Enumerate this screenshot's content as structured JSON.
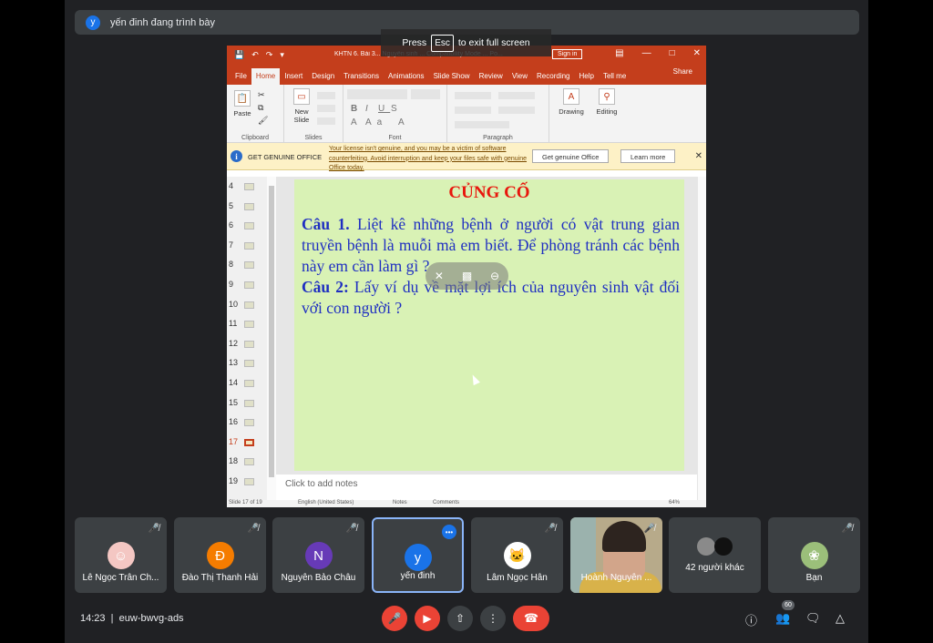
{
  "meet": {
    "presenter_initial": "y",
    "presenter_banner": "yến đinh đang trình bày",
    "fullscreen_press": "Press",
    "fullscreen_key": "Esc",
    "fullscreen_suffix": "to exit full screen",
    "time": "14:23",
    "separator": "|",
    "meeting_code": "euw-bwvg-ads",
    "people_count": "60",
    "participants": [
      {
        "name": "Lê Ngọc Trân Ch...",
        "initial": "",
        "color": "#f4c7c3"
      },
      {
        "name": "Đào Thị Thanh Hải",
        "initial": "Đ",
        "color": "#f57c00"
      },
      {
        "name": "Nguyễn Bảo Châu",
        "initial": "N",
        "color": "#673ab7"
      },
      {
        "name": "yến đinh",
        "initial": "y",
        "color": "#1a73e8"
      },
      {
        "name": "Lâm Ngọc Hân",
        "initial": "",
        "color": "#ffffff"
      },
      {
        "name": "Hoành Nguyễn ...",
        "initial": "",
        "color": ""
      },
      {
        "name": "42 người khác",
        "initial": "",
        "color": ""
      },
      {
        "name": "Bạn",
        "initial": "",
        "color": "#9bbf7a"
      }
    ]
  },
  "ppt": {
    "doc_title": "KHTN 6. Bài 3... Nguyên sinh ... Compatibility Mode ... Po...",
    "sign_in": "Sign in",
    "tabs": [
      "File",
      "Home",
      "Insert",
      "Design",
      "Transitions",
      "Animations",
      "Slide Show",
      "Review",
      "View",
      "Recording",
      "Help",
      "Tell me"
    ],
    "share": "Share",
    "ribbon": {
      "paste": "Paste",
      "new_slide_1": "New",
      "new_slide_2": "Slide",
      "drawing": "Drawing",
      "editing": "Editing",
      "group_clipboard": "Clipboard",
      "group_slides": "Slides",
      "group_font": "Font",
      "group_paragraph": "Paragraph"
    },
    "genuine": {
      "title": "GET GENUINE OFFICE",
      "message": "Your license isn't genuine, and you may be a victim of software counterfeiting. Avoid interruption and keep your files safe with genuine Office today.",
      "button_get": "Get genuine Office",
      "button_learn": "Learn more"
    },
    "thumb_numbers": [
      "4",
      "5",
      "6",
      "7",
      "8",
      "9",
      "10",
      "11",
      "12",
      "13",
      "14",
      "15",
      "16",
      "17",
      "18",
      "19"
    ],
    "selected_slide": "17",
    "slide": {
      "title": "CỦNG CỐ",
      "q1_label": "Câu 1.",
      "q1_text": " Liệt kê những bệnh ở người có vật trung gian truyền bệnh là muỗi mà em biết.  Để phòng tránh các bệnh này em cần làm gì ?",
      "q2_label": "Câu 2:",
      "q2_text": " Lấy ví dụ về mặt lợi ích của nguyên sinh vật đối với con người ?"
    },
    "notes_placeholder": "Click to add notes",
    "status": {
      "slide_of": "Slide 17 of 19",
      "language": "English (United States)",
      "notes": "Notes",
      "comments": "Comments",
      "zoom": "64%"
    }
  }
}
